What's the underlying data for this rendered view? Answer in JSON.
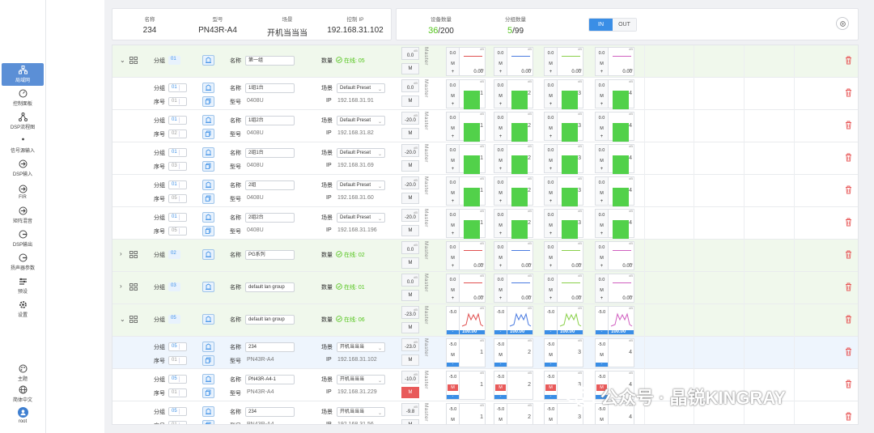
{
  "nav": {
    "items": [
      {
        "label": "局域网",
        "icon": "lan-icon",
        "active": true
      },
      {
        "label": "控制面板",
        "icon": "dashboard-icon"
      },
      {
        "label": "DSP流程图",
        "icon": "flow-icon"
      },
      {
        "label": "信号源输入",
        "icon": "location-icon"
      },
      {
        "label": "DSP输入",
        "icon": "arrow-in-icon"
      },
      {
        "label": "FIR",
        "icon": "arrow-in-icon"
      },
      {
        "label": "矩阵混音",
        "icon": "arrow-in-icon"
      },
      {
        "label": "DSP输出",
        "icon": "arrow-out-icon"
      },
      {
        "label": "扬声器参数",
        "icon": "arrow-out-icon"
      },
      {
        "label": "预设",
        "icon": "preset-icon"
      },
      {
        "label": "设置",
        "icon": "gear-icon"
      }
    ],
    "bottom": [
      {
        "label": "主题",
        "icon": "palette-icon"
      },
      {
        "label": "简体中文",
        "icon": "globe-icon"
      },
      {
        "label": "root",
        "icon": "user-icon"
      }
    ]
  },
  "device": {
    "name_label": "名称",
    "name": "234",
    "model_label": "型号",
    "model": "PN43R-A4",
    "scene_label": "场景",
    "scene": "开机当当当",
    "ip_label": "控制 IP",
    "ip": "192.168.31.102"
  },
  "stats": {
    "count_label": "设备数量",
    "count_online": "36",
    "count_total": "/200",
    "group_label": "分组数量",
    "group_online": "5",
    "group_total": "/99",
    "in_label": "IN",
    "out_label": "OUT"
  },
  "labels": {
    "group": "分组",
    "seq": "序号",
    "name": "名称",
    "model": "型号",
    "scene": "场景",
    "ip": "IP",
    "count": "数量",
    "master": "Master",
    "m": "M",
    "plus": "+",
    "minus": "-",
    "db": "dB",
    "ms": "ms"
  },
  "rows": [
    {
      "type": "group",
      "expanded": true,
      "group": "01",
      "name": "第一组",
      "online": "在线: 05",
      "mval": "0.0",
      "chan": "flat",
      "cvals": [
        "0.0",
        "0.0",
        "0.0",
        "0.0"
      ],
      "pvals": [
        "0.00",
        "0.00",
        "0.00",
        "0.00"
      ],
      "colors": [
        "#e05050",
        "#4a7be0",
        "#8ad04a",
        "#d060c0"
      ]
    },
    {
      "type": "device",
      "group": "01",
      "seq": "01",
      "name": "1组1台",
      "model": "0408U",
      "scene": "Default Preset",
      "ip": "192.168.31.91",
      "mval": "0.0",
      "chan": "green",
      "cvals": [
        "0.0",
        "0.0",
        "0.0",
        "0.0"
      ],
      "nums": [
        "1",
        "2",
        "3",
        "4"
      ]
    },
    {
      "type": "device",
      "group": "01",
      "seq": "02",
      "name": "1组2台",
      "model": "0408U",
      "scene": "Default Preset",
      "ip": "192.168.31.82",
      "mval": "-20.0",
      "chan": "green",
      "cvals": [
        "0.0",
        "0.0",
        "0.0",
        "0.0"
      ],
      "nums": [
        "1",
        "2",
        "3",
        "4"
      ]
    },
    {
      "type": "device",
      "group": "01",
      "seq": "03",
      "name": "2组1台",
      "model": "0408U",
      "scene": "Default Preset",
      "ip": "192.168.31.69",
      "mval": "-20.0",
      "chan": "green",
      "cvals": [
        "0.0",
        "0.0",
        "0.0",
        "0.0"
      ],
      "nums": [
        "1",
        "2",
        "3",
        "4"
      ]
    },
    {
      "type": "device",
      "group": "01",
      "seq": "05",
      "name": "2组",
      "model": "0408U",
      "scene": "Default Preset",
      "ip": "192.168.31.60",
      "mval": "-20.0",
      "chan": "green",
      "cvals": [
        "0.0",
        "0.0",
        "0.0",
        "0.0"
      ],
      "nums": [
        "1",
        "2",
        "3",
        "4"
      ]
    },
    {
      "type": "device",
      "group": "01",
      "seq": "05",
      "name": "2组2台",
      "model": "0408U",
      "scene": "Default Preset",
      "ip": "192.168.31.196",
      "mval": "-20.0",
      "chan": "green",
      "cvals": [
        "0.0",
        "0.0",
        "0.0",
        "0.0"
      ],
      "nums": [
        "1",
        "2",
        "3",
        "4"
      ]
    },
    {
      "type": "group",
      "expanded": false,
      "group": "02",
      "name": "PG系列",
      "online": "在线: 02",
      "mval": "0.0",
      "chan": "flat",
      "cvals": [
        "0.0",
        "0.0",
        "0.0",
        "0.0"
      ],
      "pvals": [
        "0.00",
        "0.00",
        "0.00",
        "0.00"
      ],
      "colors": [
        "#e05050",
        "#4a7be0",
        "#8ad04a",
        "#d060c0"
      ]
    },
    {
      "type": "group",
      "expanded": false,
      "group": "03",
      "name": "default lan group",
      "online": "在线: 01",
      "mval": "0.0",
      "chan": "flat",
      "cvals": [
        "0.0",
        "0.0",
        "0.0",
        "0.0"
      ],
      "pvals": [
        "0.00",
        "0.00",
        "0.00",
        "0.00"
      ],
      "colors": [
        "#e05050",
        "#4a7be0",
        "#8ad04a",
        "#d060c0"
      ]
    },
    {
      "type": "group",
      "expanded": true,
      "group": "05",
      "name": "default lan group",
      "online": "在线: 06",
      "mval": "-23.0",
      "chan": "wave",
      "cvals": [
        "-5.0",
        "-5.0",
        "-5.0",
        "-5.0"
      ],
      "pvals": [
        "100.00",
        "100.00",
        "100.00",
        "100.00"
      ],
      "colors": [
        "#e05050",
        "#4a7be0",
        "#8ad04a",
        "#d060c0"
      ]
    },
    {
      "type": "device",
      "selected": true,
      "group": "05",
      "seq": "01",
      "name": "234",
      "model": "PN43R-A4",
      "scene": "开机当当当",
      "ip": "192.168.31.102",
      "mval": "-23.0",
      "chan": "pn",
      "cvals": [
        "-5.0",
        "-5.0",
        "-5.0",
        "-5.0"
      ],
      "nums": [
        "1",
        "2",
        "3",
        "4"
      ]
    },
    {
      "type": "device",
      "group": "05",
      "seq": "01",
      "name": "PN43R-A4-1",
      "model": "PN43R-A4",
      "scene": "开机当当当",
      "ip": "192.168.31.229",
      "mval": "-10.0",
      "mred": true,
      "chan": "pnred",
      "cvals": [
        "-5.0",
        "-5.0",
        "-5.0",
        "-5.0"
      ],
      "nums": [
        "1",
        "2",
        "3",
        "4"
      ]
    },
    {
      "type": "device",
      "group": "05",
      "seq": "01",
      "name": "234",
      "model": "PN43R-A4",
      "scene": "开机当当当",
      "ip": "192.168.31.56",
      "mval": "-9.8",
      "chan": "pn",
      "cvals": [
        "-5.0",
        "-5.0",
        "-5.0",
        "-5.0"
      ],
      "nums": [
        "1",
        "2",
        "3",
        "4"
      ]
    }
  ],
  "watermark": "公众号 · 晶锐KINGRAY"
}
